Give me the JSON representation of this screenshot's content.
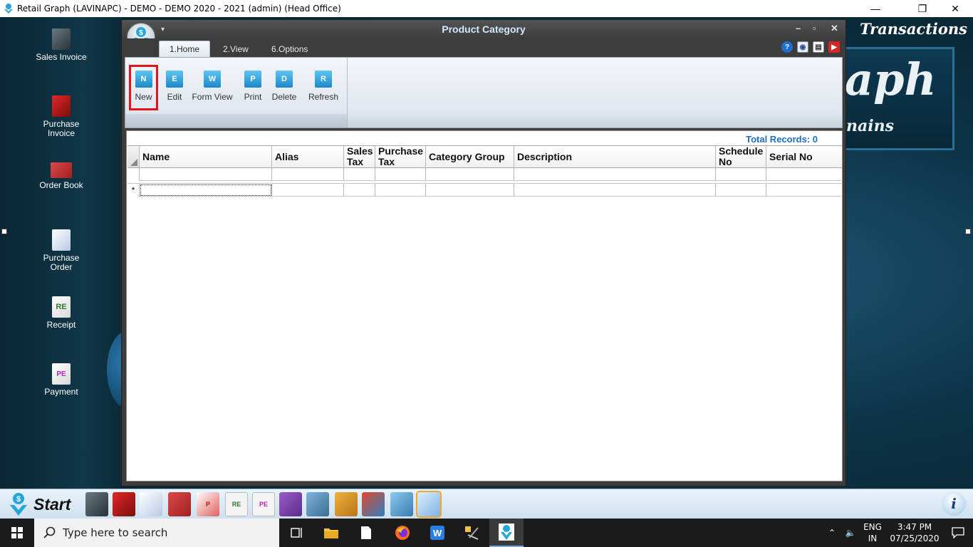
{
  "app": {
    "window_title": "Retail Graph (LAVINAPC) - DEMO - DEMO  2020 - 2021 (admin) (Head Office)"
  },
  "desktop": {
    "items": [
      {
        "label": "Sales Invoice",
        "icon": "sales-invoice-icon"
      },
      {
        "label": "Purchase Invoice",
        "icon": "purchase-invoice-icon"
      },
      {
        "label": "Order Book",
        "icon": "order-book-icon"
      },
      {
        "label": "Purchase Order",
        "icon": "purchase-order-icon"
      },
      {
        "label": "Receipt",
        "icon": "receipt-icon"
      },
      {
        "label": "Payment",
        "icon": "payment-icon"
      }
    ],
    "banner_title": "Transactions",
    "banner_word_large": "aph",
    "banner_word_small": "nains"
  },
  "product_category": {
    "title": "Product Category",
    "tabs": [
      {
        "label": "1.Home",
        "active": true
      },
      {
        "label": "2.View",
        "active": false
      },
      {
        "label": "6.Options",
        "active": false
      }
    ],
    "ribbon_buttons": [
      {
        "label": "New",
        "glyph": "N",
        "highlighted": true
      },
      {
        "label": "Edit",
        "glyph": "E",
        "highlighted": false
      },
      {
        "label": "Form View",
        "glyph": "W",
        "highlighted": false
      },
      {
        "label": "Print",
        "glyph": "P",
        "highlighted": false
      },
      {
        "label": "Delete",
        "glyph": "D",
        "highlighted": false
      },
      {
        "label": "Refresh",
        "glyph": "R",
        "highlighted": false
      }
    ],
    "total_records_label": "Total Records: 0",
    "columns": [
      "Name",
      "Alias",
      "Sales Tax",
      "Purchase Tax",
      "Category Group",
      "Description",
      "Schedule No",
      "Serial No"
    ],
    "new_row_marker": "*"
  },
  "launchbar": {
    "start_label": "Start"
  },
  "taskbar": {
    "search_placeholder": "Type here to search",
    "language": "ENG",
    "region": "IN",
    "time": "3:47 PM",
    "date": "07/25/2020"
  },
  "colors": {
    "total_records": "#1e6fc1",
    "highlight_border": "#e3141b",
    "title_text": "#cfe7ff"
  }
}
